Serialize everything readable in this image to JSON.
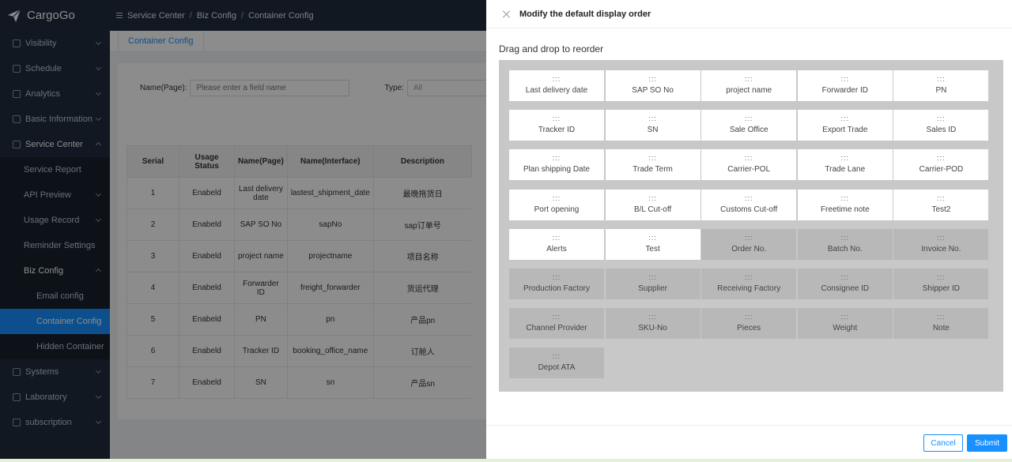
{
  "app": {
    "name": "CargoGo"
  },
  "breadcrumb": [
    "Service Center",
    "Biz Config",
    "Container Config"
  ],
  "sidebar": {
    "items": [
      {
        "label": "Visibility"
      },
      {
        "label": "Schedule"
      },
      {
        "label": "Analytics"
      },
      {
        "label": "Basic Information"
      },
      {
        "label": "Service Center"
      }
    ],
    "service_center_children": [
      {
        "label": "Service Report"
      },
      {
        "label": "API Preview"
      },
      {
        "label": "Usage Record"
      },
      {
        "label": "Reminder Settings"
      },
      {
        "label": "Biz Config"
      }
    ],
    "biz_config_children": [
      {
        "label": "Email config"
      },
      {
        "label": "Container Config"
      },
      {
        "label": "Hidden Container"
      }
    ],
    "bottom_items": [
      {
        "label": "Systems"
      },
      {
        "label": "Laboratory"
      },
      {
        "label": "subscription"
      }
    ]
  },
  "tabs": [
    {
      "label": "Container Config"
    }
  ],
  "filter": {
    "name_label": "Name(Page):",
    "name_placeholder": "Please enter a field name",
    "type_label": "Type:",
    "type_value": "All"
  },
  "table": {
    "headers": [
      "Serial",
      "Usage Status",
      "Name(Page)",
      "Name(Interface)",
      "Description"
    ],
    "rows": [
      [
        "1",
        "Enabeld",
        "Last delivery date",
        "lastest_shipment_date",
        "最晚拖货日"
      ],
      [
        "2",
        "Enabeld",
        "SAP SO No",
        "sapNo",
        "sap订单号"
      ],
      [
        "3",
        "Enabeld",
        "project name",
        "projectname",
        "项目名称"
      ],
      [
        "4",
        "Enabeld",
        "Forwarder ID",
        "freight_forwarder",
        "货运代理"
      ],
      [
        "5",
        "Enabeld",
        "PN",
        "pn",
        "产品pn"
      ],
      [
        "6",
        "Enabeld",
        "Tracker ID",
        "booking_office_name",
        "订舱人"
      ],
      [
        "7",
        "Enabeld",
        "SN",
        "sn",
        "产品sn"
      ]
    ]
  },
  "drawer": {
    "title": "Modify the default display order",
    "hint": "Drag and drop to reorder",
    "handle": ":::",
    "cards": [
      {
        "label": "Last delivery date",
        "selected": true
      },
      {
        "label": "SAP SO No",
        "selected": true
      },
      {
        "label": "project name",
        "selected": true
      },
      {
        "label": "Forwarder ID",
        "selected": true
      },
      {
        "label": "PN",
        "selected": true
      },
      {
        "label": "Tracker ID",
        "selected": true
      },
      {
        "label": "SN",
        "selected": true
      },
      {
        "label": "Sale Office",
        "selected": true
      },
      {
        "label": "Export Trade",
        "selected": true
      },
      {
        "label": "Sales ID",
        "selected": true
      },
      {
        "label": "Plan shipping Date",
        "selected": true
      },
      {
        "label": "Trade Term",
        "selected": true
      },
      {
        "label": "Carrier-POL",
        "selected": true
      },
      {
        "label": "Trade Lane",
        "selected": true
      },
      {
        "label": "Carrier-POD",
        "selected": true
      },
      {
        "label": "Port opening",
        "selected": true
      },
      {
        "label": "B/L Cut-off",
        "selected": true
      },
      {
        "label": "Customs Cut-off",
        "selected": true
      },
      {
        "label": "Freetime note",
        "selected": true
      },
      {
        "label": "Test2",
        "selected": true
      },
      {
        "label": "Alerts",
        "selected": true
      },
      {
        "label": "Test",
        "selected": true
      },
      {
        "label": "Order No.",
        "selected": false
      },
      {
        "label": "Batch No.",
        "selected": false
      },
      {
        "label": "Invoice No.",
        "selected": false
      },
      {
        "label": "Production Factory",
        "selected": false
      },
      {
        "label": "Supplier",
        "selected": false
      },
      {
        "label": "Receiving Factory",
        "selected": false
      },
      {
        "label": "Consignee ID",
        "selected": false
      },
      {
        "label": "Shipper ID",
        "selected": false
      },
      {
        "label": "Channel Provider",
        "selected": false
      },
      {
        "label": "SKU-No",
        "selected": false
      },
      {
        "label": "Pieces",
        "selected": false
      },
      {
        "label": "Weight",
        "selected": false
      },
      {
        "label": "Note",
        "selected": false
      },
      {
        "label": "Depot ATA",
        "selected": false
      }
    ],
    "cancel_label": "Cancel",
    "submit_label": "Submit"
  },
  "colors": {
    "primary": "#1890ff",
    "sidebar_bg": "#1f2d3d"
  }
}
